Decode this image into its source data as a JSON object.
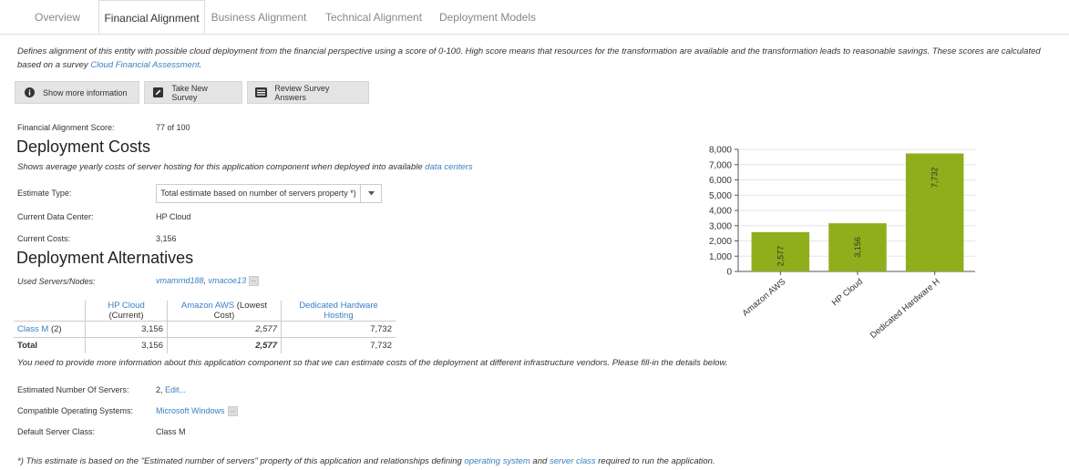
{
  "tabs": [
    {
      "label": "Overview",
      "active": false
    },
    {
      "label": "Financial Alignment",
      "active": true
    },
    {
      "label": "Business Alignment",
      "active": false
    },
    {
      "label": "Technical Alignment",
      "active": false
    },
    {
      "label": "Deployment Models",
      "active": false
    }
  ],
  "description": {
    "text": "Defines alignment of this entity with possible cloud deployment from the financial perspective using a score of 0-100. High score means that resources for the transformation are available and the transformation leads to reasonable savings. These scores are calculated based on a survey ",
    "link": "Cloud Financial Assessment",
    "suffix": "."
  },
  "buttons": {
    "show_more": "Show more information",
    "take_survey": "Take New Survey",
    "review_answers": "Review Survey Answers"
  },
  "score": {
    "label": "Financial Alignment Score:",
    "value": "77 of 100"
  },
  "deployment_costs": {
    "title": "Deployment Costs",
    "subtitle": "Shows average yearly costs of server hosting for this application component when deployed into available ",
    "subtitle_link": "data centers",
    "estimate_type_label": "Estimate Type:",
    "estimate_type_value": "Total estimate based on number of servers property *)",
    "current_dc_label": "Current Data Center:",
    "current_dc_value": "HP Cloud",
    "current_costs_label": "Current Costs:",
    "current_costs_value": "3,156"
  },
  "alternatives": {
    "title": "Deployment Alternatives",
    "used_servers_label": "Used Servers/Nodes:",
    "server1": "vmamrnd188",
    "sep": ", ",
    "server2": "vmacoe13",
    "more": "...",
    "table": {
      "col1_link": "HP Cloud",
      "col1_suffix": " (Current)",
      "col2_link": "Amazon AWS",
      "col2_suffix": " (Lowest Cost)",
      "col3_link": "Dedicated Hardware Hosting",
      "row1_label_link": "Class M",
      "row1_label_suffix": " (2)",
      "row1": [
        "3,156",
        "2,577",
        "7,732"
      ],
      "total_label": "Total",
      "total": [
        "3,156",
        "2,577",
        "7,732"
      ]
    }
  },
  "info_note": "You need to provide more information about this application component so that we can estimate costs of the deployment at different infrastructure vendors. Please fill-in the details below.",
  "details": {
    "servers_label": "Estimated Number Of Servers:",
    "servers_value": "2, ",
    "servers_edit": "Edit...",
    "os_label": "Compatible Operating Systems:",
    "os_value": "Microsoft Windows",
    "os_more": "...",
    "class_label": "Default Server Class:",
    "class_value": "Class M"
  },
  "footnote": {
    "text1": "*) This estimate is based on the \"Estimated number of servers\" property of this application and relationships defining ",
    "link1": "operating system",
    "text2": " and ",
    "link2": "server class",
    "text3": " required to run the application."
  },
  "chart_data": {
    "type": "bar",
    "categories": [
      "Amazon AWS",
      "HP Cloud",
      "Dedicated Hardware H"
    ],
    "values": [
      2577,
      3156,
      7732
    ],
    "value_labels": [
      "2,577",
      "3,156",
      "7,732"
    ],
    "ylim": [
      0,
      8000
    ],
    "yticks": [
      "0",
      "1,000",
      "2,000",
      "3,000",
      "4,000",
      "5,000",
      "6,000",
      "7,000",
      "8,000"
    ],
    "bar_color": "#8fae1b",
    "grid": true,
    "legend": "none"
  }
}
